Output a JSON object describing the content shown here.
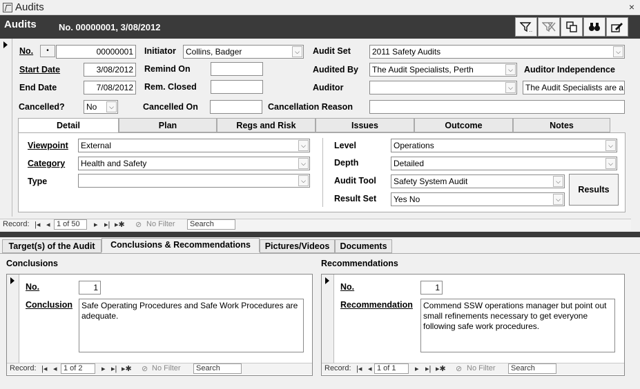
{
  "window": {
    "title": "Audits",
    "close": "×"
  },
  "header": {
    "title": "Audits",
    "subtitle": "No. 00000001, 3/08/2012",
    "toolbar_icons": [
      "filter-icon",
      "clear-filter-icon",
      "copy-icon",
      "binoculars-icon",
      "edit-icon"
    ]
  },
  "record": {
    "no_label": "No.",
    "no_btn": "•",
    "no_value": "00000001",
    "start_date_label": "Start Date",
    "start_date": "3/08/2012",
    "end_date_label": "End Date",
    "end_date": "7/08/2012",
    "initiator_label": "Initiator",
    "initiator": "Collins, Badger",
    "remind_on_label": "Remind On",
    "remind_on": "",
    "rem_closed_label": "Rem. Closed",
    "rem_closed": "",
    "audit_set_label": "Audit Set",
    "audit_set": "2011 Safety Audits",
    "audited_by_label": "Audited By",
    "audited_by": "The Audit Specialists, Perth",
    "auditor_label": "Auditor",
    "auditor": "",
    "auditor_independence_label": "Auditor Independence",
    "auditor_independence": "The Audit Specialists are a",
    "cancelled_label": "Cancelled?",
    "cancelled": "No",
    "cancelled_on_label": "Cancelled On",
    "cancelled_on": "",
    "cancellation_reason_label": "Cancellation Reason",
    "cancellation_reason": ""
  },
  "tabs": [
    "Detail",
    "Plan",
    "Regs and Risk",
    "Issues",
    "Outcome",
    "Notes"
  ],
  "detail": {
    "viewpoint_label": "Viewpoint",
    "viewpoint": "External",
    "category_label": "Category",
    "category": "Health and Safety",
    "type_label": "Type",
    "type": "",
    "level_label": "Level",
    "level": "Operations",
    "depth_label": "Depth",
    "depth": "Detailed",
    "audit_tool_label": "Audit Tool",
    "audit_tool": "Safety System Audit",
    "result_set_label": "Result Set",
    "result_set": "Yes No",
    "results_btn": "Results"
  },
  "nav_main": {
    "record_label": "Record:",
    "position": "1 of 50",
    "no_filter": "No Filter",
    "search": "Search"
  },
  "bottom_tabs": [
    "Target(s) of the Audit",
    "Conclusions & Recommendations",
    "Pictures/Videos",
    "Documents"
  ],
  "conclusions": {
    "heading": "Conclusions",
    "no_label": "No.",
    "no_value": "1",
    "field_label": "Conclusion",
    "text": "Safe Operating Procedures and Safe Work Procedures are adequate.",
    "nav": {
      "record_label": "Record:",
      "position": "1 of 2",
      "no_filter": "No Filter",
      "search": "Search"
    }
  },
  "recommendations": {
    "heading": "Recommendations",
    "no_label": "No.",
    "no_value": "1",
    "field_label": "Recommendation",
    "text": "Commend SSW operations manager but point out small refinements necessary to get everyone following safe work procedures.",
    "nav": {
      "record_label": "Record:",
      "position": "1 of 1",
      "no_filter": "No Filter",
      "search": "Search"
    }
  },
  "nav_glyphs": {
    "first": "|◂",
    "prev": "◂",
    "next": "▸",
    "last": "▸|",
    "new": "▸✱",
    "filter_icon": "⊘"
  }
}
